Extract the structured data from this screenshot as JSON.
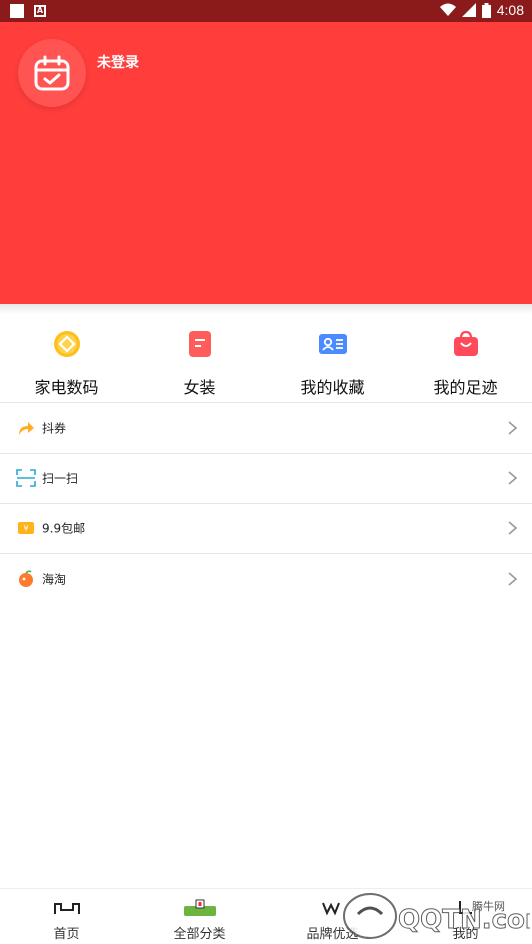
{
  "status_bar": {
    "time": "4:08"
  },
  "header": {
    "login_status": "未登录",
    "bg_color": "#ff3d3b",
    "avatar_icon": "calendar-check-icon"
  },
  "quick_links": [
    {
      "label": "家电数码",
      "icon": "coin-diamond-icon",
      "color": "#ffb800"
    },
    {
      "label": "女装",
      "icon": "document-icon",
      "color": "#ff5c5c"
    },
    {
      "label": "我的收藏",
      "icon": "id-card-icon",
      "color": "#4a8cff"
    },
    {
      "label": "我的足迹",
      "icon": "shopping-bag-icon",
      "color": "#ff4a5a"
    }
  ],
  "menu": [
    {
      "label": "抖券",
      "icon": "share-arrow-icon"
    },
    {
      "label": "扫一扫",
      "icon": "scan-icon"
    },
    {
      "label": "9.9包邮",
      "icon": "ticket-icon"
    },
    {
      "label": "海淘",
      "icon": "peach-icon"
    }
  ],
  "bottom_nav": [
    {
      "label": "首页",
      "icon": "home-icon"
    },
    {
      "label": "全部分类",
      "icon": "category-icon"
    },
    {
      "label": "品牌优选",
      "icon": "brand-icon"
    },
    {
      "label": "我的",
      "icon": "profile-icon"
    }
  ],
  "watermark": {
    "text": "腾牛网",
    "brand": "QQTN.com"
  }
}
